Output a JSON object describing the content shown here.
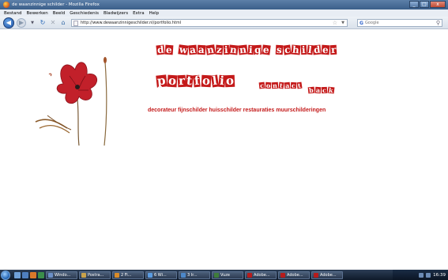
{
  "window": {
    "title": "de waanzinnige schilder - Mozilla Firefox",
    "controls": [
      "_",
      "□",
      "x"
    ]
  },
  "menu": [
    "Bestand",
    "Bewerken",
    "Beeld",
    "Geschiedenis",
    "Bladwijzers",
    "Extra",
    "Help"
  ],
  "toolbar": {
    "back_icon": "back-arrow-icon",
    "forward_icon": "forward-arrow-icon",
    "url": "http://www.dewaanzinnigeschilder.nl/portfolio.html",
    "search_placeholder": "Google",
    "search_engine_letter": "G"
  },
  "page": {
    "title": "de waanzinnige schilder",
    "nav": {
      "portfolio": "portfolio",
      "contact": "contact",
      "back": "back"
    },
    "tagline": "decorateur fijnschilder huisschilder restauraties muurschilderingen",
    "accent_color": "#c41a1a"
  },
  "taskbar": {
    "tasks": [
      "Windo...",
      "Postra...",
      "2 Fi...",
      "6 Wi...",
      "3 Ir...",
      "Vuze",
      "Adobe...",
      "Adobe...",
      "Adobe..."
    ],
    "task_colors": [
      "#6b8fc7",
      "#c9a24a",
      "#d98b28",
      "#5a9be0",
      "#4c87c9",
      "#3f7d3a",
      "#b71c1c",
      "#b71c1c",
      "#b71c1c"
    ],
    "clock": "16:39"
  }
}
